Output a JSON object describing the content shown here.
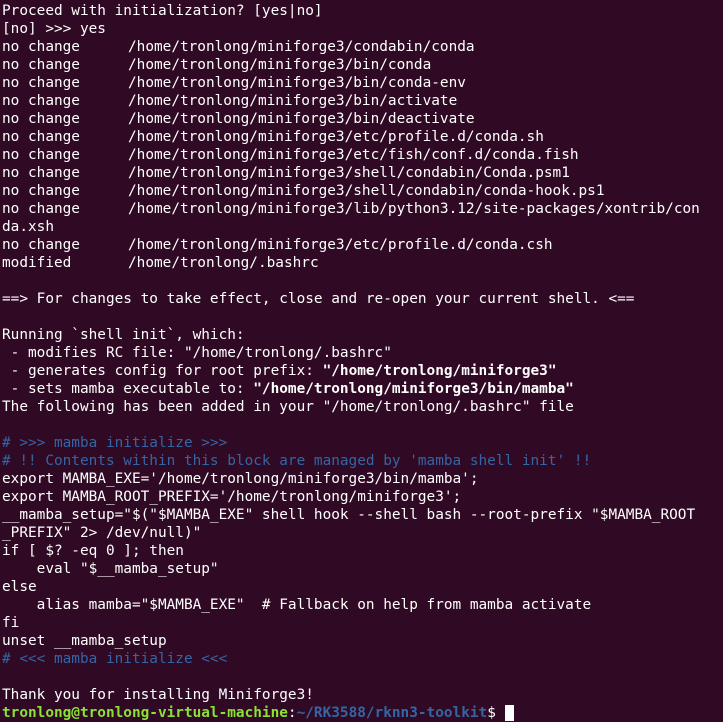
{
  "terminal": {
    "prompt_question": "Proceed with initialization? [yes|no]",
    "prompt_answer_marker": "[no] >>> ",
    "prompt_answer": "yes",
    "file_changes": [
      {
        "status": "no change",
        "path": "/home/tronlong/miniforge3/condabin/conda"
      },
      {
        "status": "no change",
        "path": "/home/tronlong/miniforge3/bin/conda"
      },
      {
        "status": "no change",
        "path": "/home/tronlong/miniforge3/bin/conda-env"
      },
      {
        "status": "no change",
        "path": "/home/tronlong/miniforge3/bin/activate"
      },
      {
        "status": "no change",
        "path": "/home/tronlong/miniforge3/bin/deactivate"
      },
      {
        "status": "no change",
        "path": "/home/tronlong/miniforge3/etc/profile.d/conda.sh"
      },
      {
        "status": "no change",
        "path": "/home/tronlong/miniforge3/etc/fish/conf.d/conda.fish"
      },
      {
        "status": "no change",
        "path": "/home/tronlong/miniforge3/shell/condabin/Conda.psm1"
      },
      {
        "status": "no change",
        "path": "/home/tronlong/miniforge3/shell/condabin/conda-hook.ps1"
      },
      {
        "status": "no change",
        "path": "/home/tronlong/miniforge3/lib/python3.12/site-packages/xontrib/con",
        "wrap": "da.xsh"
      },
      {
        "status": "no change",
        "path": "/home/tronlong/miniforge3/etc/profile.d/conda.csh"
      },
      {
        "status": "modified",
        "path": "/home/tronlong/.bashrc"
      }
    ],
    "effect_notice": "==> For changes to take effect, close and re-open your current shell. <==",
    "shell_init_header": "Running `shell init`, which:",
    "shell_init_items": [
      {
        "prefix": " - modifies RC file: ",
        "value": "\"/home/tronlong/.bashrc\"",
        "bold": false
      },
      {
        "prefix": " - generates config for root prefix: ",
        "value": "\"/home/tronlong/miniforge3\"",
        "bold": true
      },
      {
        "prefix": " - sets mamba executable to: ",
        "value": "\"/home/tronlong/miniforge3/bin/mamba\"",
        "bold": true
      }
    ],
    "added_notice": "The following has been added in your \"/home/tronlong/.bashrc\" file",
    "bashrc_block": [
      "# >>> mamba initialize >>>",
      "# !! Contents within this block are managed by 'mamba shell init' !!",
      "export MAMBA_EXE='/home/tronlong/miniforge3/bin/mamba';",
      "export MAMBA_ROOT_PREFIX='/home/tronlong/miniforge3';",
      "__mamba_setup=\"$(\"$MAMBA_EXE\" shell hook --shell bash --root-prefix \"$MAMBA_ROOT",
      "_PREFIX\" 2> /dev/null)\"",
      "if [ $? -eq 0 ]; then",
      "    eval \"$__mamba_setup\"",
      "else",
      "    alias mamba=\"$MAMBA_EXE\"  # Fallback on help from mamba activate",
      "fi",
      "unset __mamba_setup",
      "# <<< mamba initialize <<<"
    ],
    "thanks": "Thank you for installing Miniforge3!",
    "shell_prompt": {
      "user_host": "tronlong@tronlong-virtual-machine",
      "separator": ":",
      "path": "~/RK3588/rknn3-toolkit",
      "symbol": "$ "
    },
    "colors": {
      "background": "#300a24",
      "foreground": "#ffffff",
      "comment": "#3465a4",
      "prompt_user": "#8ae234",
      "prompt_path": "#3465a4"
    }
  }
}
